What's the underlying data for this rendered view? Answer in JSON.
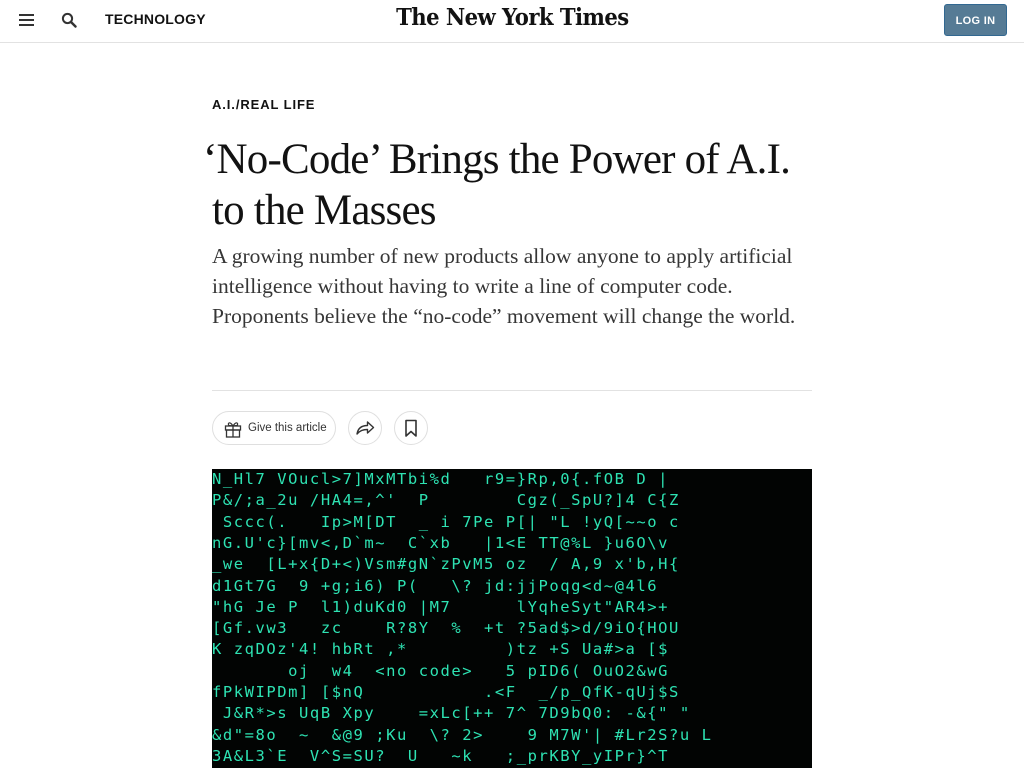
{
  "header": {
    "section": "TECHNOLOGY",
    "masthead": "The New York Times",
    "login": "LOG IN"
  },
  "article": {
    "kicker": "A.I./REAL LIFE",
    "headline_line1": "‘No-Code’ Brings the Power of A.I.",
    "headline_line2": "to the Masses",
    "summary": "A growing number of new products allow anyone to apply artificial intelligence without having to write a line of computer code. Proponents believe the “no-code” movement will change the world.",
    "gift_label": "Give this article"
  },
  "hero_image": {
    "lines": [
      "N_Hl7 VOucl>7]MxMTbi%d   r9=}Rp,0{.fOB D |",
      "P&/;a_2u /HA4=,^'  P        Cgz(_SpU?]4 C{Z",
      " Sccc(.   Ip>M[DT  _ i 7Pe P[| \"L !yQ[~~o c",
      "nG.U'c}[mv<,D`m~  C`xb   |1<E TT@%L }u6O\\v",
      "_we  [L+x{D+<)Vsm#gN`zPvM5 oz  / A,9 x'b,H{",
      "d1Gt7G  9 +g;i6) P(   \\? jd:jjPoqg<d~@4l6",
      "\"hG Je P  l1)duKd0 |M7      lYqheSyt\"AR4>+",
      "[Gf.vw3   zc    R?8Y  %  +t ?5ad$>d/9iO{HOU",
      "K zqDOz'4! hbRt ,*         )tz +S Ua#>a [$",
      "       oj  w4  <no code>   5 pID6( OuO2&wG",
      "fPkWIPDm] [$nQ           .<F  _/p_QfK-qUj$S",
      " J&R*>s UqB Xpy    =xLc[++ 7^ 7D9bQ0: -&{\" \"",
      "&d\"=8o  ~  &@9 ;Ku  \\? 2>    9 M7W'| #Lr2S?u L",
      "3A&L3`E  V^S=SU?  U   ~k   ;_prKBY_yIPr}^T"
    ]
  },
  "colors": {
    "accent_login": "#567b95",
    "code_green": "#2ee3b3",
    "hero_background": "#020403"
  }
}
